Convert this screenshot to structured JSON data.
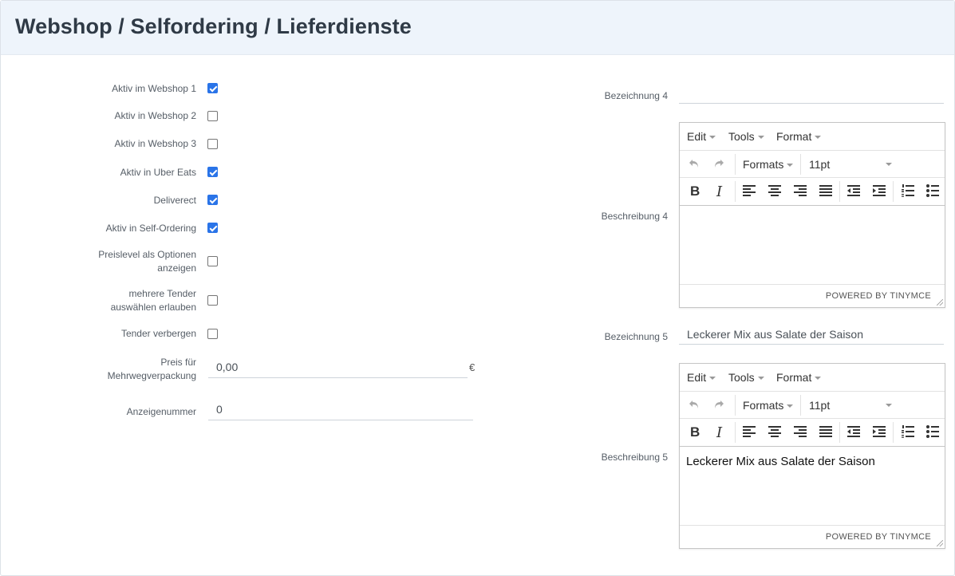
{
  "header": {
    "title": "Webshop / Selfordering / Lieferdienste"
  },
  "left": {
    "checkboxes": [
      {
        "label": "Aktiv im Webshop 1",
        "checked": true
      },
      {
        "label": "Aktiv in Webshop 2",
        "checked": false
      },
      {
        "label": "Aktiv in Webshop 3",
        "checked": false
      },
      {
        "label": "Aktiv in Uber Eats",
        "checked": true
      },
      {
        "label": "Deliverect",
        "checked": true
      },
      {
        "label": "Aktiv in Self-Ordering",
        "checked": true
      },
      {
        "label_line1": "Preislevel als Optionen",
        "label_line2": "anzeigen",
        "checked": false
      },
      {
        "label_line1": "mehrere Tender",
        "label_line2": "auswählen erlauben",
        "checked": false
      },
      {
        "label": "Tender verbergen",
        "checked": false
      }
    ],
    "packaging_price": {
      "label_line1": "Preis für",
      "label_line2": "Mehrwegverpackung",
      "value": "0,00",
      "unit": "€"
    },
    "display_number": {
      "label": "Anzeigenummer",
      "value": "0"
    }
  },
  "right": {
    "bezeichnung4": {
      "label": "Bezeichnung 4",
      "value": ""
    },
    "beschreibung4": {
      "label": "Beschreibung 4",
      "content": ""
    },
    "bezeichnung5": {
      "label": "Bezeichnung 5",
      "value": "Leckerer Mix aus Salate der Saison"
    },
    "beschreibung5": {
      "label": "Beschreibung 5",
      "content": "Leckerer Mix aus Salate der Saison"
    }
  },
  "editor": {
    "menu": {
      "edit": "Edit",
      "tools": "Tools",
      "format": "Format"
    },
    "formats_label": "Formats",
    "font_size": "11pt",
    "bold": "B",
    "italic": "I",
    "powered_by": "POWERED BY TINYMCE"
  },
  "colors": {
    "accent": "#2a74e8",
    "header_bg": "#eef4fb"
  }
}
